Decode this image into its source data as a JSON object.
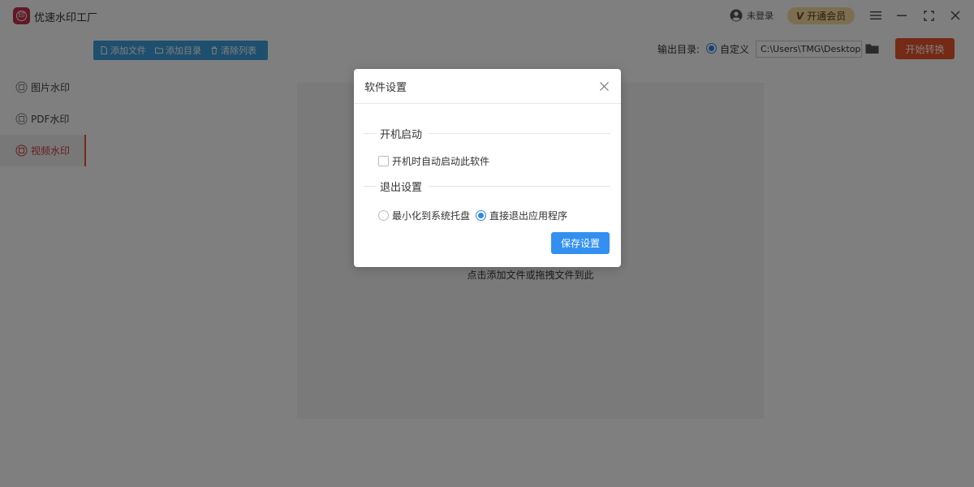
{
  "app": {
    "title": "优速水印工厂",
    "login_label": "未登录",
    "vip_label": "开通会员",
    "brand_color": "#c5304a"
  },
  "window_controls": {
    "menu_icon": "menu-icon",
    "minimize_icon": "minimize-icon",
    "maximize_icon": "maximize-icon",
    "close_icon": "close-icon"
  },
  "toolbar": {
    "add_file": "添加文件",
    "add_folder": "添加目录",
    "clear_list": "清除列表",
    "color": "#3f9fdc"
  },
  "output": {
    "label": "输出目录:",
    "custom_label": "自定义",
    "path": "C:\\Users\\TMG\\Desktop",
    "start_label": "开始转换",
    "start_color": "#e9542b"
  },
  "sidebar": {
    "items": [
      {
        "label": "图片水印",
        "active": false
      },
      {
        "label": "PDF水印",
        "active": false
      },
      {
        "label": "视频水印",
        "active": true
      }
    ]
  },
  "main": {
    "drop_hint": "点击添加文件或拖拽文件到此"
  },
  "dialog": {
    "title": "软件设置",
    "startup_section": "开机启动",
    "startup_checkbox": "开机时自动启动此软件",
    "startup_checked": false,
    "exit_section": "退出设置",
    "exit_options": [
      {
        "label": "最小化到系统托盘",
        "selected": false
      },
      {
        "label": "直接退出应用程序",
        "selected": true
      }
    ],
    "save_label": "保存设置",
    "accent_color": "#3390f0"
  }
}
